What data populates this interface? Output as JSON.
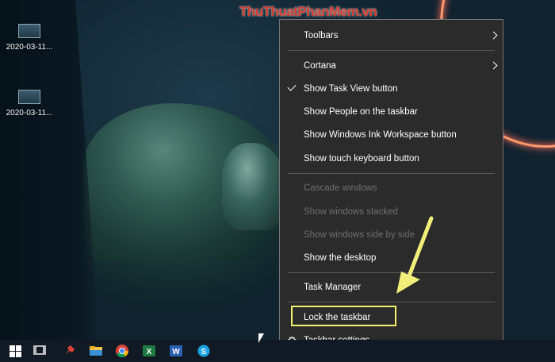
{
  "watermark": "ThuThuatPhanMem.vn",
  "desktop_icons": [
    {
      "label": "2020-03-11..."
    },
    {
      "label": "2020-03-11..."
    }
  ],
  "context_menu": {
    "items": [
      {
        "label": "Toolbars"
      },
      {
        "label": "Cortana"
      },
      {
        "label": "Show Task View button",
        "checked": true
      },
      {
        "label": "Show People on the taskbar"
      },
      {
        "label": "Show Windows Ink Workspace button"
      },
      {
        "label": "Show touch keyboard button"
      },
      {
        "label": "Cascade windows",
        "disabled": true
      },
      {
        "label": "Show windows stacked",
        "disabled": true
      },
      {
        "label": "Show windows side by side",
        "disabled": true
      },
      {
        "label": "Show the desktop"
      },
      {
        "label": "Task Manager"
      },
      {
        "label": "Lock the taskbar",
        "highlighted": true
      },
      {
        "label": "Taskbar settings"
      }
    ]
  },
  "taskbar": {
    "icons": [
      "windows-start-icon",
      "task-view-icon",
      "pinned-app-icon",
      "file-explorer-icon",
      "chrome-icon",
      "excel-icon",
      "word-icon",
      "skype-icon"
    ]
  },
  "colors": {
    "menu_bg": "#2b2b2b",
    "highlight_border": "#f4ee72",
    "arrow": "#f2ee7a",
    "watermark": "#d13b2e"
  }
}
